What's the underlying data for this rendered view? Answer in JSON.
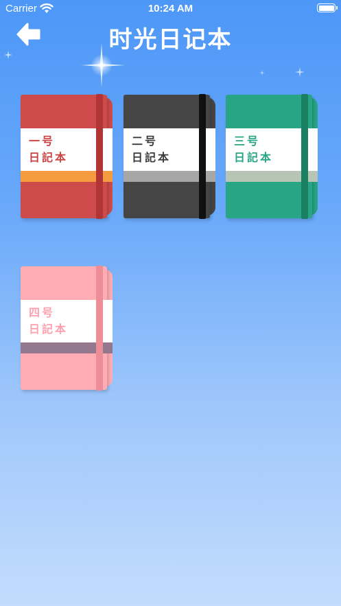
{
  "status_bar": {
    "carrier": "Carrier",
    "time": "10:24 AM"
  },
  "header": {
    "title": "时光日记本",
    "back_icon": "arrow-left-icon"
  },
  "colors": {
    "bg_top": "#4d97f7",
    "bg_bottom": "#c3dcfd"
  },
  "notebooks": [
    {
      "line1": "一号",
      "line2": "日記本",
      "cover": "#cd4b4b",
      "band": "#b23535",
      "stripe": "#f59b40",
      "pages": "#cd4b4b",
      "text": "#c94141"
    },
    {
      "line1": "二号",
      "line2": "日記本",
      "cover": "#454545",
      "band": "#111111",
      "stripe": "#a7a7a7",
      "pages": "#454545",
      "text": "#3a3a3a"
    },
    {
      "line1": "三号",
      "line2": "日記本",
      "cover": "#27a584",
      "band": "#1a7f63",
      "stripe": "#b7c6b4",
      "pages": "#27a584",
      "text": "#27a584"
    },
    {
      "line1": "四号",
      "line2": "日記本",
      "cover": "#ffacb5",
      "band": "#ec8d98",
      "stripe": "#94788d",
      "pages": "#ffacb5",
      "text": "#ff9fad"
    }
  ]
}
